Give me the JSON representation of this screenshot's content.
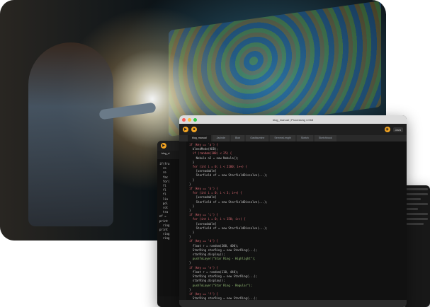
{
  "window_front": {
    "title": "blog_manual | Processing 4.0b8",
    "tabs": [
      "blog_manual",
      "Jacinde",
      "Blob",
      "Gastlaumine",
      "SemmeLength",
      "Sketch",
      "Sketchbook"
    ],
    "mode_label": "Java",
    "code_lines": [
      "if (key == 'a') {",
      "  blendMode(ADD);",
      "  if (random(100) < 25) {",
      "    Nebula n2 = new Nebula();",
      "  }",
      "  for (int i = 0; i < 2100; i++) {",
      "    [unreadable]",
      "    Starfield sf = new StarfieldDissolve(...);",
      "  }",
      "}",
      "",
      "if (key == 'b') {",
      "  for (int i = 0; i < 3; i++) {",
      "    [unreadable]",
      "    Starfield sf = new StarfieldDissolve(...);",
      "  }",
      "}",
      "",
      "if (key == 'c') {",
      "  for (int i = 0; i < 150; i++) {",
      "    [unreadable]",
      "    Starfield sf = new StarfieldDissolve(...);",
      "  }",
      "}",
      "",
      "if (key == 'd') {",
      "  float r = random(200, 400);",
      "  StarRing starRing = new StarRing(...);",
      "  starRing.display();",
      "  pushToLayer(\"Star Ring - Highlight\");",
      "}",
      "",
      "if (key == 'e') {",
      "  float r = random(110, 440);",
      "  StarRing starRing = new StarRing(...);",
      "  starRing.display();",
      "  pushToLayer(\"Star Ring - Regular\");",
      "}",
      "",
      "if (key == 'f') {",
      "  StarRing starRing = new StarRing(...);",
      "  starRing.display();",
      "  pushToLayer(\"Star Ring - Extended\");",
      "}",
      "",
      "if (key == 's') {"
    ]
  },
  "window_back": {
    "tab": "blog_vi",
    "code_lines": [
      "if(fra",
      "  ro",
      "  re",
      "  fac",
      "",
      "  for(",
      "  fl",
      "  fl",
      "  fl",
      "  lin",
      "",
      "  pol",
      "  rot",
      "  tra",
      "",
      "nf = ",
      "",
      "print",
      "  ring",
      "",
      "print",
      "  ring",
      "  ring"
    ]
  },
  "colors": {
    "accent": "#f5a623",
    "editor_bg": "#111111",
    "keyword": "#e06c75",
    "string": "#98c379"
  }
}
